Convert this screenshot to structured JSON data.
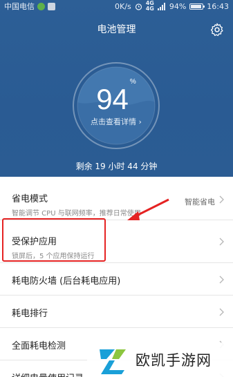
{
  "statusbar": {
    "carrier": "中国电信",
    "speed": "0K/s",
    "net_4g_top": "4G",
    "net_4g": "4G",
    "battery_pct": "94%",
    "time": "16:43"
  },
  "header": {
    "title": "电池管理",
    "battery_value": "94",
    "percent_sign": "%",
    "detail_link": "点击查看详情 ›",
    "remaining": "剩余 19 小时 44 分钟"
  },
  "list": {
    "items": [
      {
        "title": "省电模式",
        "subtitle": "智能调节 CPU 与联网频率，推荐日常使用",
        "value": "智能省电"
      },
      {
        "title": "受保护应用",
        "subtitle": "锁屏后，5 个应用保持运行"
      },
      {
        "title": "耗电防火墙 (后台耗电应用)"
      },
      {
        "title": "耗电排行"
      },
      {
        "title": "全面耗电检测"
      },
      {
        "title": "详细电量使用记录"
      }
    ]
  },
  "watermark": {
    "text": "欧凯手游网"
  },
  "colors": {
    "header_bg": "#2b5c93",
    "highlight": "#e52222"
  }
}
